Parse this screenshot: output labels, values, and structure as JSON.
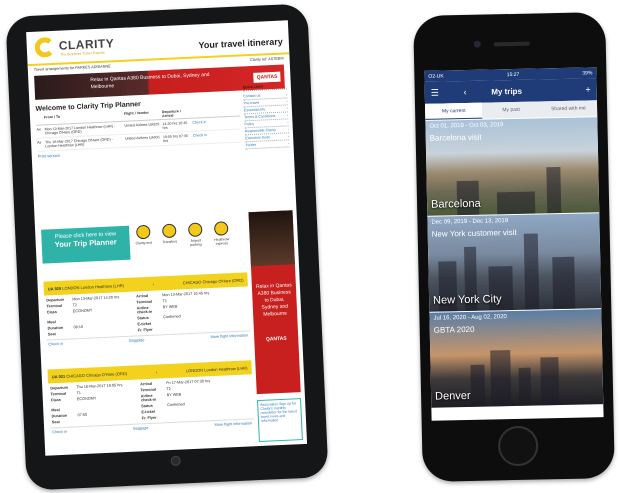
{
  "tablet": {
    "logo": {
      "name": "CLARITY",
      "tagline": "The Business Travel Experts"
    },
    "title": "Your travel itinerary",
    "traveller": "Travel arrangements for PARKES ADRIANNE",
    "ref": "Clarity ref: AS7EEM",
    "promo": {
      "text": "Relax in Qantas A380 Business to Dubai, Sydney and Melbourne",
      "brand": "QANTAS"
    },
    "welcome": "Welcome to Clarity Trip Planner",
    "quick_links": {
      "heading": "Quick Links",
      "items": [
        "Contact us",
        "Pre-travel",
        "Essential info",
        "Terms & Conditions",
        "Policy",
        "Responsible Clarity",
        "Executive Suite",
        "Twitter"
      ]
    },
    "table": {
      "headers": [
        "From / To",
        "Flight / Vendor",
        "Departure / Arrival"
      ],
      "rows": [
        {
          "type": "Air",
          "route": "Mon 13-Mar-2017 London Heathrow (LHR) - Chicago O'Hare (ORD)",
          "vendor": "United Airlines UA929",
          "times": "14:20 hrs 16:45 hrs",
          "link": "Check in"
        },
        {
          "type": "Air",
          "route": "Thu 16-Mar-2017 Chicago O'Hare (ORD) - London Heathrow (LHR)",
          "vendor": "United Airlines UA931",
          "times": "19:05 hrs 07:30 hrs",
          "link": "Check in"
        }
      ]
    },
    "print_label": "Print version",
    "planner": {
      "line1": "Please click here to view",
      "line2": "Your Trip Planner"
    },
    "planner_icons": [
      "Clarity text",
      "Transfers",
      "Airport parking",
      "Heathrow express"
    ],
    "side_ad": {
      "text": "Relax in Qantas A380 Business to Dubai, Sydney and Melbourne",
      "brand": "QANTAS"
    },
    "side_box": "Association Sign up for Clarity's monthly newsletter for the latest travel news and information",
    "flights": [
      {
        "code": "UA 929",
        "from_city": "LONDON",
        "from_airport": "London Heathrow (LHR)",
        "to_city": "CHICAGO",
        "to_airport": "Chicago O'Hare (ORD)",
        "departure": "Mon 13-Mar-2017 14:20 hrs",
        "arrival": "Mon 13-Mar-2017 16:45 hrs",
        "terminal": "T2",
        "terminal2": "T1",
        "class": "ECONOMY",
        "checkin": "BY WEB",
        "meal": "",
        "status": "Confirmed",
        "duration": "08:15",
        "eticket": "",
        "seat": "",
        "flyer": "",
        "links": [
          "Check in",
          "Baggage",
          "More flight information"
        ]
      },
      {
        "code": "UA 931",
        "from_city": "CHICAGO",
        "from_airport": "Chicago O'Hare (ORD)",
        "to_city": "LONDON",
        "to_airport": "London Heathrow (LHR)",
        "departure": "Thu 16-Mar-2017 19:05 hrs",
        "arrival": "Fri 17-Mar-2017 07:30 hrs",
        "terminal": "T1",
        "terminal2": "T2",
        "class": "ECONOMY",
        "checkin": "BY WEB",
        "meal": "",
        "status": "Confirmed",
        "duration": "07:50",
        "eticket": "",
        "seat": "",
        "flyer": "",
        "links": [
          "Check in",
          "Baggage",
          "More flight information"
        ]
      }
    ],
    "flight_labels": {
      "departure": "Departure",
      "arrival": "Arrival",
      "terminal": "Terminal",
      "class": "Class",
      "checkin": "Airline check-in",
      "meal": "Meal",
      "status": "Status",
      "duration": "Duration",
      "eticket": "E-ticket",
      "seat": "Seat",
      "flyer": "Fr. Flyer"
    }
  },
  "phone": {
    "status": {
      "carrier": "O2-UK",
      "time": "15:27",
      "battery": "39%"
    },
    "title": "My trips",
    "tabs": [
      "My current",
      "My past",
      "Shared with me"
    ],
    "active_tab": 0,
    "trips": [
      {
        "dates": "Oct 01, 2019 - Oct 03, 2019",
        "name": "Barcelona visit",
        "city": "Barcelona"
      },
      {
        "dates": "Dec 09, 2019 - Dec 13, 2019",
        "name": "New York customer visit",
        "city": "New York City"
      },
      {
        "dates": "Jul 16, 2020 - Aug 02, 2020",
        "name": "GBTA 2020",
        "city": "Denver"
      }
    ]
  }
}
